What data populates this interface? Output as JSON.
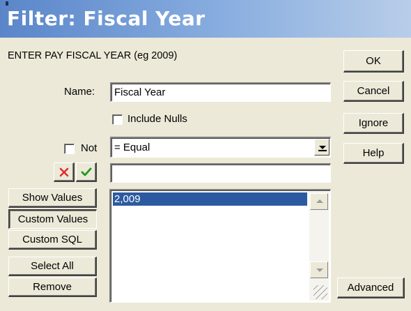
{
  "title": "Filter: Fiscal Year",
  "prompt": "ENTER PAY FISCAL YEAR (eg 2009)",
  "name": {
    "label": "Name:",
    "value": "Fiscal Year"
  },
  "include_nulls": {
    "label": "Include Nulls",
    "checked": false
  },
  "not": {
    "label": "Not",
    "checked": false
  },
  "operator": {
    "selected": "= Equal"
  },
  "value_input": {
    "value": ""
  },
  "side_buttons": {
    "show_values": "Show Values",
    "custom_values": "Custom Values",
    "custom_sql": "Custom SQL",
    "select_all": "Select All",
    "remove": "Remove"
  },
  "values_list": [
    "2,009"
  ],
  "dialog_buttons": {
    "ok": "OK",
    "cancel": "Cancel",
    "ignore": "Ignore",
    "help": "Help",
    "advanced": "Advanced"
  },
  "colors": {
    "accent": "#2c5aa0",
    "title_bg": "#5a86c9",
    "cancel_x": "#e03030",
    "accept_check": "#1c9a1c"
  },
  "icons": {
    "cancel_value": "close-x-icon",
    "accept_value": "checkmark-icon"
  }
}
